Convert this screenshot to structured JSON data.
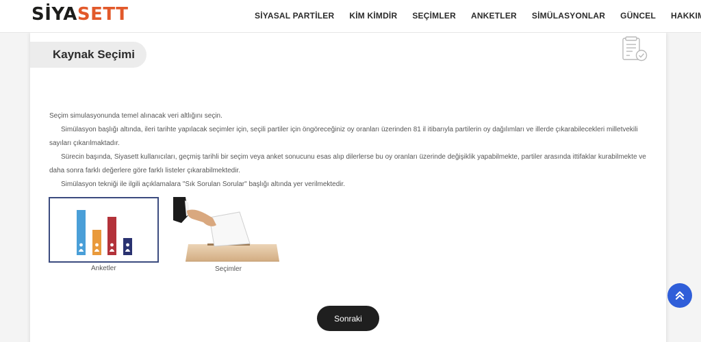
{
  "brand": {
    "part1": "SİYA",
    "part2": "SETT"
  },
  "nav": {
    "items": [
      "SİYASAL PARTİLER",
      "KİM KİMDİR",
      "SEÇİMLER",
      "ANKETLER",
      "SİMÜLASYONLAR",
      "GÜNCEL",
      "HAKKIMIZDA"
    ]
  },
  "page": {
    "title": "Kaynak Seçimi"
  },
  "description": {
    "lead": "Seçim simulasyonunda temel alınacak veri altlığını seçin.",
    "p1": "Simülasyon başlığı altında, ileri tarihte yapılacak seçimler için, seçili partiler için öngöreceğiniz oy oranları üzerinden 81 il itibarıyla partilerin oy dağılımları ve illerde çıkarabilecekleri milletvekili sayıları çıkarılmaktadır.",
    "p2": "Sürecin başında, Siyasett kullanıcıları, geçmiş tarihli bir seçim veya anket sonucunu esas alıp dilerlerse bu oy oranları üzerinde değişiklik yapabilmekte, partiler arasında ittifaklar kurabilmekte ve daha sonra farklı değerlere göre farklı listeler çıkarabilmektedir.",
    "p3": "Simülasyon tekniği ile ilgili açıklamalara \"Sık Sorulan Sorular\" başlığı altında yer verilmektedir."
  },
  "options": {
    "surveys": {
      "label": "Anketler",
      "selected": true
    },
    "elections": {
      "label": "Seçimler",
      "selected": false
    }
  },
  "actions": {
    "next": "Sonraki"
  },
  "colors": {
    "brand_dark": "#1d1d1b",
    "brand_orange": "#e2592a",
    "bar_blue": "#4a9fd8",
    "bar_orange": "#e99a3c",
    "bar_red": "#b3323a",
    "bar_navy": "#2a3270",
    "selection_border": "#3a4a7e",
    "button_dark": "#1f1f1f",
    "scroll_button": "#2f5ed9"
  },
  "icons": {
    "document": "document-check-icon",
    "scroll_top": "double-chevron-up-icon"
  }
}
